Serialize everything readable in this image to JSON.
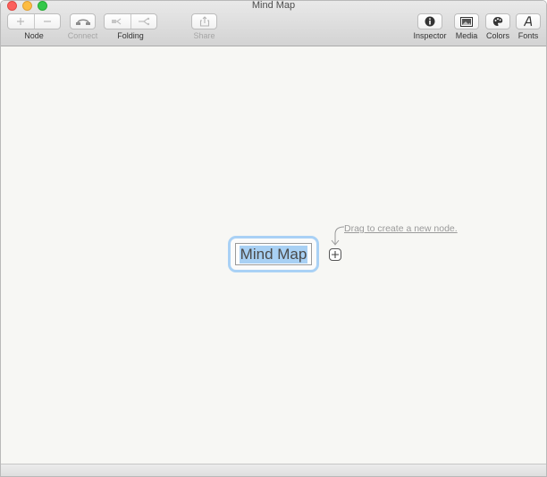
{
  "window": {
    "title": "Mind Map"
  },
  "toolbar": {
    "node_label": "Node",
    "connect_label": "Connect",
    "folding_label": "Folding",
    "share_label": "Share",
    "inspector_label": "Inspector",
    "media_label": "Media",
    "colors_label": "Colors",
    "fonts_label": "Fonts"
  },
  "canvas": {
    "central_node_text": "Mind Map",
    "hint_text": "Drag to create a new node."
  },
  "colors": {
    "selection": "#a8d0f4",
    "node_border": "#a9d1f5"
  }
}
